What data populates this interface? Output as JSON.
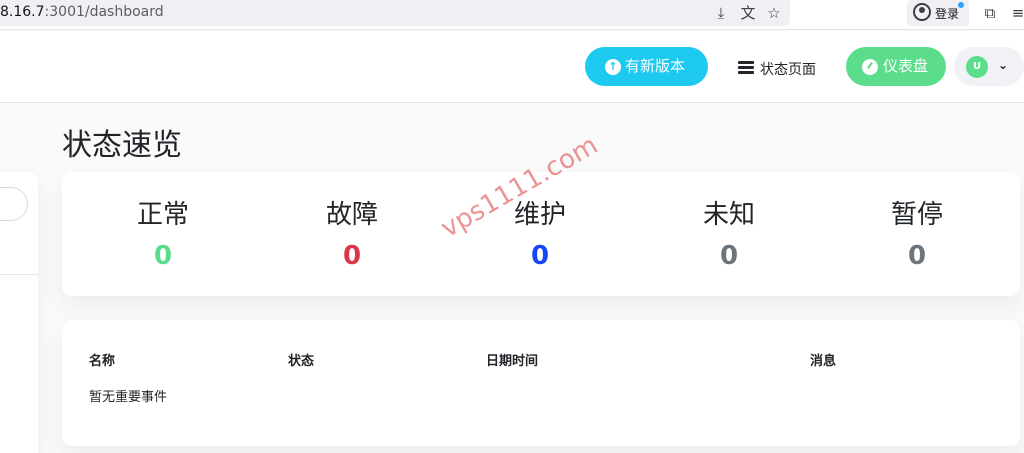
{
  "browser": {
    "url_host": "8.16.7",
    "url_rest": ":3001/dashboard",
    "login_label": "登录",
    "icons": [
      "download-icon",
      "translate-icon",
      "star-icon",
      "extensions-icon",
      "menu-icon"
    ]
  },
  "header": {
    "update_label": "有新版本",
    "status_page_label": "状态页面",
    "dashboard_label": "仪表盘",
    "avatar_letter": "U",
    "colors": {
      "update": "#1ec9f0",
      "dashboard": "#5cdd8b"
    }
  },
  "main": {
    "title": "状态速览",
    "stats": [
      {
        "label": "正常",
        "value": "0",
        "color": "#5cdd8b"
      },
      {
        "label": "故障",
        "value": "0",
        "color": "#dc3545"
      },
      {
        "label": "维护",
        "value": "0",
        "color": "#1747f5"
      },
      {
        "label": "未知",
        "value": "0",
        "color": "#6c757d"
      },
      {
        "label": "暂停",
        "value": "0",
        "color": "#6c757d"
      }
    ],
    "events": {
      "columns": [
        "名称",
        "状态",
        "日期时间",
        "消息"
      ],
      "empty_text": "暂无重要事件"
    }
  },
  "watermark": "vps1111.com"
}
